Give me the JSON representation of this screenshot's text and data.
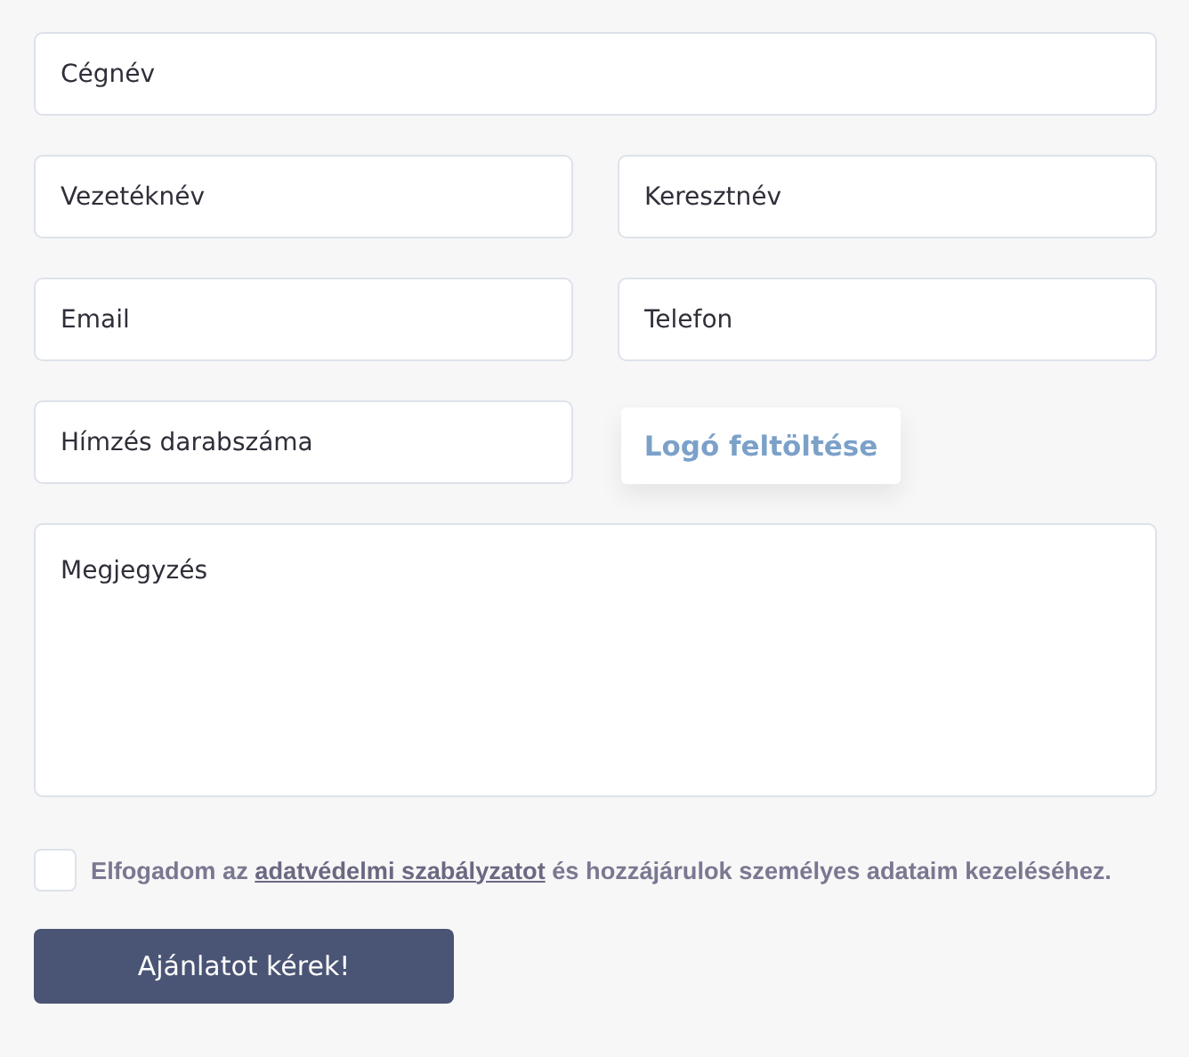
{
  "rows": [
    [
      {
        "kind": "input",
        "placeholder": "Cégnév"
      }
    ],
    [
      {
        "kind": "input",
        "placeholder": "Vezetéknév"
      },
      {
        "kind": "input",
        "placeholder": "Keresztnév"
      }
    ],
    [
      {
        "kind": "input",
        "placeholder": "Email"
      },
      {
        "kind": "input",
        "placeholder": "Telefon"
      }
    ],
    [
      {
        "kind": "input",
        "placeholder": "Hímzés darabszáma"
      },
      {
        "kind": "upload",
        "label": "Logó feltöltése"
      }
    ],
    [
      {
        "kind": "textarea",
        "placeholder": "Megjegyzés"
      }
    ]
  ],
  "consent": {
    "checked": false,
    "before": "Elfogadom az",
    "link": "adatvédelmi szabályzatot",
    "after": "és hozzájárulok személyes adataim kezeléséhez."
  },
  "submit": "Ajánlatot kérek!"
}
